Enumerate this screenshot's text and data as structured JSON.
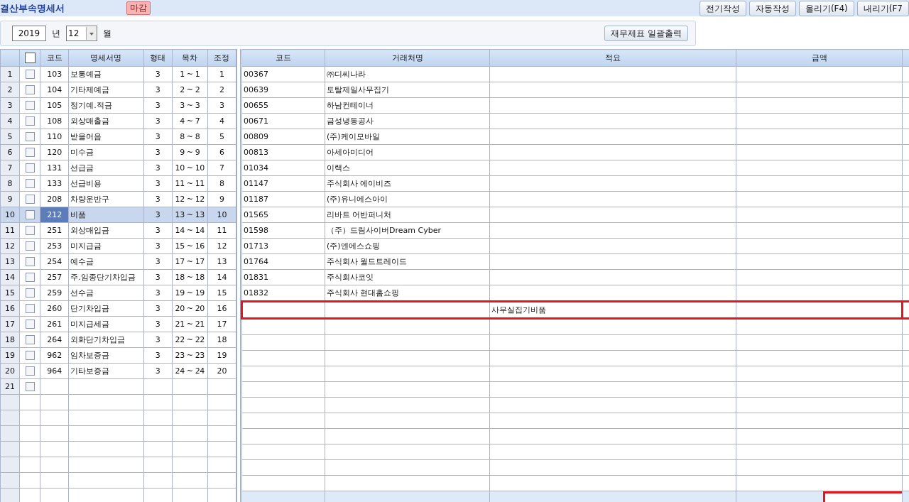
{
  "title": "결산부속명세서",
  "status_badge": "마감",
  "toolbar_buttons": [
    "전기작성",
    "자동작성",
    "올리기(F4)",
    "내리기(F7"
  ],
  "period": {
    "year": "2019",
    "year_unit": "년",
    "month": "12",
    "month_unit": "월"
  },
  "print_button": "재무제표 일괄출력",
  "statements": {
    "columns": [
      "코드",
      "명세서명",
      "형태",
      "목차",
      "조정"
    ],
    "header_checked": false,
    "rows": [
      {
        "no": "1",
        "checked": false,
        "selected": false,
        "code": "103",
        "name": "보통예금",
        "type": "3",
        "index": "1 ~ 1",
        "adjust": "1"
      },
      {
        "no": "2",
        "checked": false,
        "selected": false,
        "code": "104",
        "name": "기타제예금",
        "type": "3",
        "index": "2 ~ 2",
        "adjust": "2"
      },
      {
        "no": "3",
        "checked": false,
        "selected": false,
        "code": "105",
        "name": "정기예.적금",
        "type": "3",
        "index": "3 ~ 3",
        "adjust": "3"
      },
      {
        "no": "4",
        "checked": false,
        "selected": false,
        "code": "108",
        "name": "외상매출금",
        "type": "3",
        "index": "4 ~ 7",
        "adjust": "4"
      },
      {
        "no": "5",
        "checked": false,
        "selected": false,
        "code": "110",
        "name": "받을어음",
        "type": "3",
        "index": "8 ~ 8",
        "adjust": "5"
      },
      {
        "no": "6",
        "checked": false,
        "selected": false,
        "code": "120",
        "name": "미수금",
        "type": "3",
        "index": "9 ~ 9",
        "adjust": "6"
      },
      {
        "no": "7",
        "checked": false,
        "selected": false,
        "code": "131",
        "name": "선급금",
        "type": "3",
        "index": "10 ~ 10",
        "adjust": "7"
      },
      {
        "no": "8",
        "checked": false,
        "selected": false,
        "code": "133",
        "name": "선급비용",
        "type": "3",
        "index": "11 ~ 11",
        "adjust": "8"
      },
      {
        "no": "9",
        "checked": false,
        "selected": false,
        "code": "208",
        "name": "차량운반구",
        "type": "3",
        "index": "12 ~ 12",
        "adjust": "9"
      },
      {
        "no": "10",
        "checked": false,
        "selected": true,
        "code": "212",
        "name": "비품",
        "type": "3",
        "index": "13 ~ 13",
        "adjust": "10"
      },
      {
        "no": "11",
        "checked": false,
        "selected": false,
        "code": "251",
        "name": "외상매입금",
        "type": "3",
        "index": "14 ~ 14",
        "adjust": "11"
      },
      {
        "no": "12",
        "checked": false,
        "selected": false,
        "code": "253",
        "name": "미지급금",
        "type": "3",
        "index": "15 ~ 16",
        "adjust": "12"
      },
      {
        "no": "13",
        "checked": false,
        "selected": false,
        "code": "254",
        "name": "예수금",
        "type": "3",
        "index": "17 ~ 17",
        "adjust": "13"
      },
      {
        "no": "14",
        "checked": false,
        "selected": false,
        "code": "257",
        "name": "주.임종단기차입금",
        "type": "3",
        "index": "18 ~ 18",
        "adjust": "14"
      },
      {
        "no": "15",
        "checked": false,
        "selected": false,
        "code": "259",
        "name": "선수금",
        "type": "3",
        "index": "19 ~ 19",
        "adjust": "15"
      },
      {
        "no": "16",
        "checked": false,
        "selected": false,
        "code": "260",
        "name": "단기차입금",
        "type": "3",
        "index": "20 ~ 20",
        "adjust": "16"
      },
      {
        "no": "17",
        "checked": false,
        "selected": false,
        "code": "261",
        "name": "미지급세금",
        "type": "3",
        "index": "21 ~ 21",
        "adjust": "17"
      },
      {
        "no": "18",
        "checked": false,
        "selected": false,
        "code": "264",
        "name": "외화단기차입금",
        "type": "3",
        "index": "22 ~ 22",
        "adjust": "18"
      },
      {
        "no": "19",
        "checked": false,
        "selected": false,
        "code": "962",
        "name": "임차보증금",
        "type": "3",
        "index": "23 ~ 23",
        "adjust": "19"
      },
      {
        "no": "20",
        "checked": false,
        "selected": false,
        "code": "964",
        "name": "기타보증금",
        "type": "3",
        "index": "24 ~ 24",
        "adjust": "20"
      },
      {
        "no": "21",
        "checked": false,
        "selected": false
      }
    ]
  },
  "details": {
    "columns": [
      "코드",
      "거래처명",
      "적요",
      "금액"
    ],
    "rows": [
      {
        "code": "00367",
        "client": "㈜디씨나라",
        "outlined": false
      },
      {
        "code": "00639",
        "client": "토탈제일사무집기",
        "outlined": false
      },
      {
        "code": "00655",
        "client": "하남컨테이너",
        "outlined": false
      },
      {
        "code": "00671",
        "client": "금성냉동공사",
        "outlined": false
      },
      {
        "code": "00809",
        "client": "(주)케이모바일",
        "outlined": false
      },
      {
        "code": "00813",
        "client": "아세아미디어",
        "outlined": false
      },
      {
        "code": "01034",
        "client": "이랙스",
        "outlined": false
      },
      {
        "code": "01147",
        "client": "주식회사 에이비즈",
        "outlined": false
      },
      {
        "code": "01187",
        "client": "(주)유니에스아이",
        "outlined": false
      },
      {
        "code": "01565",
        "client": "리바트 어반퍼니처",
        "outlined": false
      },
      {
        "code": "01598",
        "client": "（주）드림사이버Dream Cyber",
        "outlined": false
      },
      {
        "code": "01713",
        "client": "(주)엔에스쇼핑",
        "outlined": false
      },
      {
        "code": "01764",
        "client": "주식회사 월드트레이드",
        "outlined": false
      },
      {
        "code": "01831",
        "client": "주식회사코잇",
        "outlined": false
      },
      {
        "code": "01832",
        "client": "주식회사 현대홈쇼핑",
        "outlined": false
      },
      {
        "memo": "사무실집기비품",
        "outlined": true
      }
    ],
    "footer": {
      "outlined": true
    }
  }
}
